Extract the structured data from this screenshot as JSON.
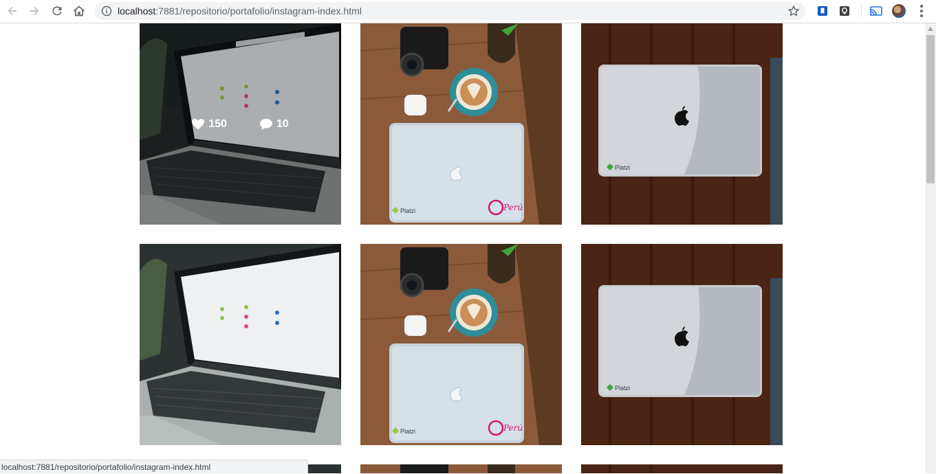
{
  "browser": {
    "url_host": "localhost",
    "url_rest": ":7881/repositorio/portafolio/instagram-index.html"
  },
  "status_bar": {
    "text": "localhost:7881/repositorio/portafolio/instagram-index.html"
  },
  "grid": {
    "photos": [
      {
        "kind": "laptop-screen"
      },
      {
        "kind": "desk-coffee",
        "sticker": "Platzi",
        "brand": "Perú"
      },
      {
        "kind": "macbook-top",
        "sticker": "Platzi"
      },
      {
        "kind": "laptop-screen"
      },
      {
        "kind": "desk-coffee",
        "sticker": "Platzi",
        "brand": "Perú"
      },
      {
        "kind": "macbook-top",
        "sticker": "Platzi"
      }
    ],
    "hover_overlay": {
      "likes": "150",
      "comments": "10"
    }
  },
  "colors": {
    "overlay": "rgba(0,0,0,0.35)",
    "wood": "#8a5a3b",
    "platzi_green": "#98ca3f",
    "peru_pink": "#d5166f"
  },
  "icons": [
    "back-arrow-icon",
    "forward-arrow-icon",
    "reload-icon",
    "home-icon",
    "info-icon",
    "star-icon",
    "bookmark-extension-icon",
    "lightbulb-extension-icon",
    "cast-icon",
    "profile-avatar",
    "menu-dots-icon",
    "heart-icon",
    "comment-icon"
  ]
}
